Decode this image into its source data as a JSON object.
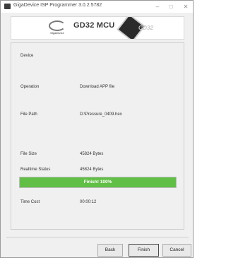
{
  "window": {
    "title": "GigaDevice ISP Programmer 3.0.2.5782",
    "controls": {
      "minimize": "–",
      "maximize": "□",
      "close": "✕"
    }
  },
  "banner": {
    "brand": "GigaDevice",
    "product": "GD32 MCU",
    "chip_text": "GD32"
  },
  "fields": {
    "device_label": "Device",
    "device_value": "",
    "operation_label": "Operation",
    "operation_value": "Download APP file",
    "file_path_label": "File Path",
    "file_path_value": "D:\\Pressure_0409.hex",
    "file_size_label": "File Size",
    "file_size_value": "45824 Bytes",
    "realtime_status_label": "Realtime Status",
    "realtime_status_value": "45824 Bytes",
    "time_cost_label": "Time Cost",
    "time_cost_value": "00:00:12"
  },
  "progress": {
    "text": "Finish!   100%",
    "percent": 100,
    "color": "#62bf45"
  },
  "buttons": {
    "back": "Back",
    "finish": "Finish",
    "cancel": "Cancel"
  }
}
